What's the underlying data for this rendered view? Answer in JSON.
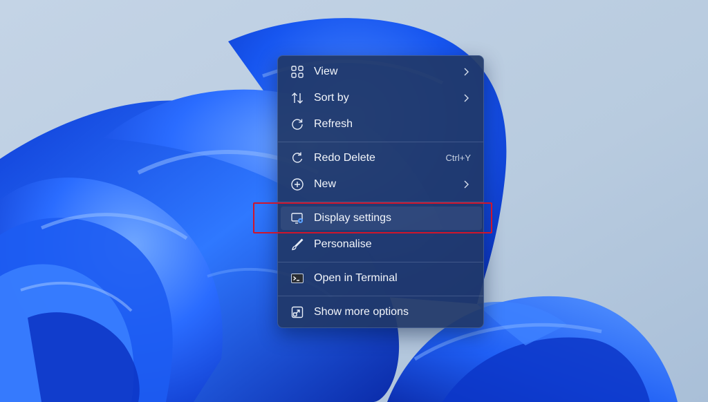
{
  "context_menu": {
    "items": [
      {
        "label": "View",
        "icon": "view-grid-icon",
        "has_submenu": true
      },
      {
        "label": "Sort by",
        "icon": "sort-icon",
        "has_submenu": true
      },
      {
        "label": "Refresh",
        "icon": "refresh-icon",
        "has_submenu": false
      },
      {
        "label": "Redo Delete",
        "icon": "redo-icon",
        "shortcut": "Ctrl+Y"
      },
      {
        "label": "New",
        "icon": "new-plus-icon",
        "has_submenu": true
      },
      {
        "label": "Display settings",
        "icon": "display-settings-icon",
        "highlighted": true
      },
      {
        "label": "Personalise",
        "icon": "brush-icon"
      },
      {
        "label": "Open in Terminal",
        "icon": "terminal-icon"
      },
      {
        "label": "Show more options",
        "icon": "show-more-options-icon"
      }
    ]
  },
  "colors": {
    "menu_background": "#203868",
    "menu_text": "#f3f6fb",
    "highlight_border": "#d0152b",
    "wallpaper_accent": "#1a5cff"
  }
}
